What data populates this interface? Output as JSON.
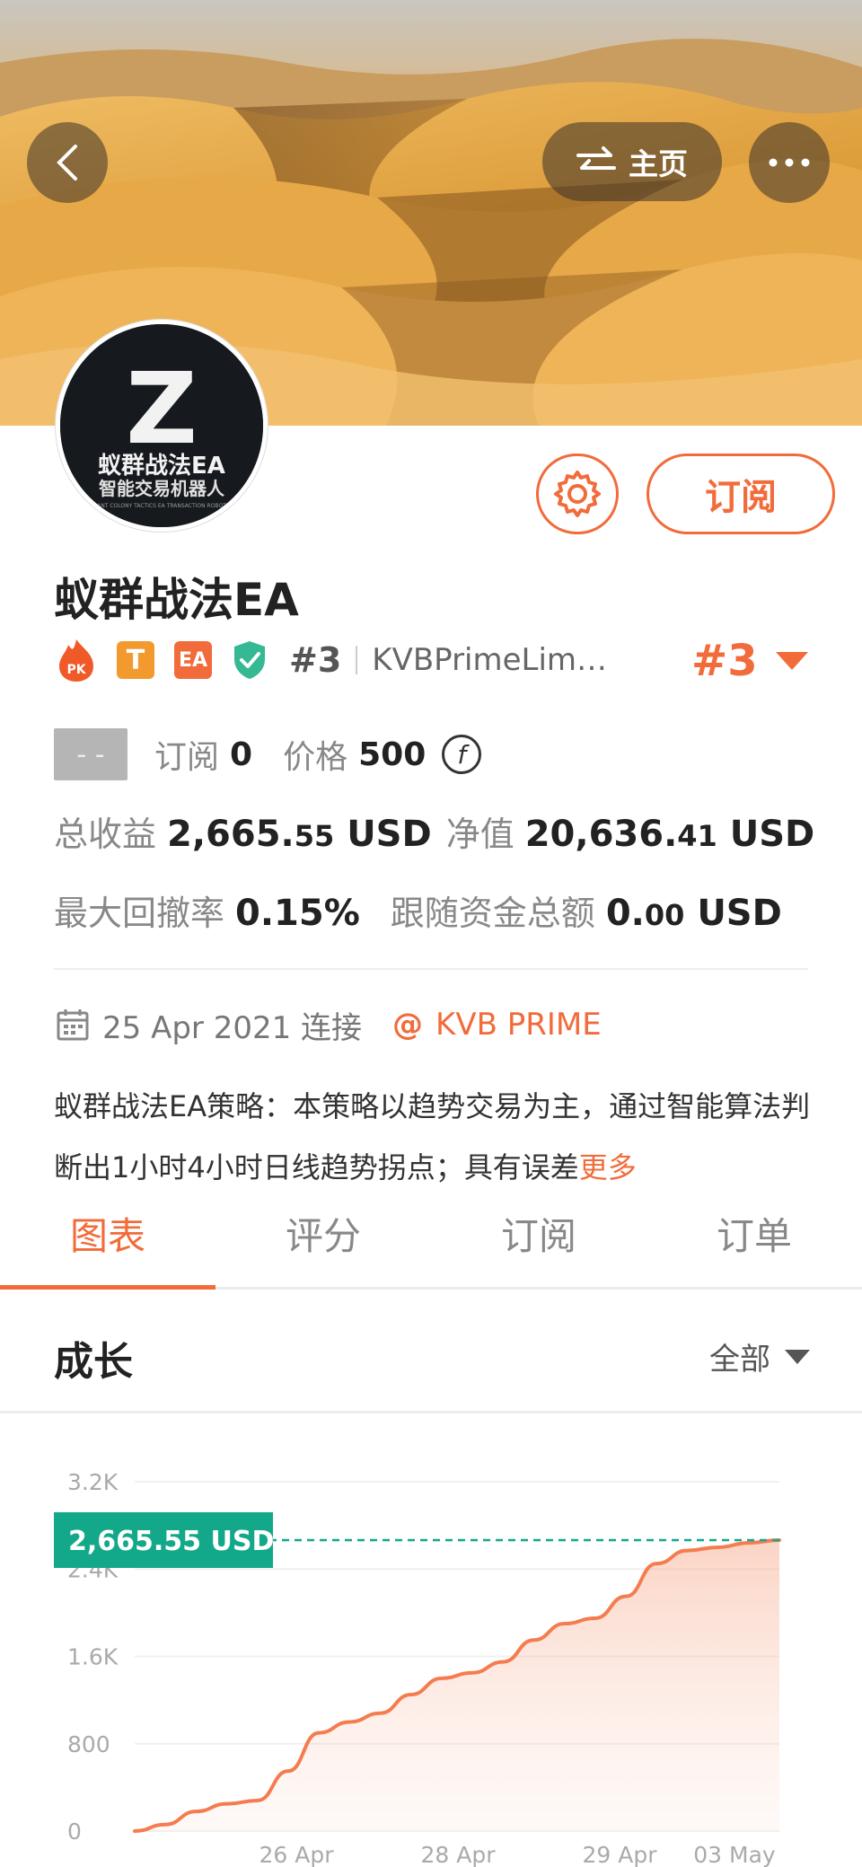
{
  "header": {
    "home_label": "主页",
    "avatar_logo_letter": "Z",
    "avatar_logo_title": "蚁群战法EA",
    "avatar_logo_subtitle": "智能交易机器人",
    "avatar_logo_tagline": "ANT COLONY TACTICS EA TRANSACTION ROBOT"
  },
  "profile": {
    "subscribe_label": "订阅",
    "name": "蚁群战法EA",
    "badges": {
      "pk": "PK",
      "t": "T",
      "ea": "EA"
    },
    "rank": "#3",
    "broker": "KVBPrimeLim…",
    "rank_big": "#3"
  },
  "stats": {
    "tag": "- -",
    "subs_label": "订阅",
    "subs_value": "0",
    "price_label": "价格",
    "price_value": "500",
    "coin_symbol": "f",
    "total_income_label": "总收益",
    "total_income_int": "2,665.",
    "total_income_dec": "55",
    "total_income_unit": "USD",
    "equity_label": "净值",
    "equity_int": "20,636.",
    "equity_dec": "41",
    "equity_unit": "USD",
    "drawdown_label": "最大回撤率",
    "drawdown_value": "0.15%",
    "follow_label": "跟随资金总额",
    "follow_int": "0.",
    "follow_dec": "00",
    "follow_unit": "USD"
  },
  "meta": {
    "connected": "25 Apr 2021 连接",
    "broker_tag": "KVB PRIME"
  },
  "description": {
    "text": "蚁群战法EA策略：本策略以趋势交易为主，通过智能算法判断出1小时4小时日线趋势拐点；具有误差",
    "more": "更多"
  },
  "tabs": [
    "图表",
    "评分",
    "订阅",
    "订单"
  ],
  "growth": {
    "title": "成长",
    "range": "全部"
  },
  "colors": {
    "accent": "#f26b3a",
    "green": "#14a88a",
    "line": "#f47c4f"
  },
  "chart_data": {
    "type": "area",
    "y_ticks": [
      "3.2K",
      "2.4K",
      "1.6K",
      "800",
      "0"
    ],
    "y_tick_values": [
      3200,
      2400,
      1600,
      800,
      0
    ],
    "x_ticks": [
      "26 Apr",
      "28 Apr",
      "29 Apr",
      "03 May"
    ],
    "ylim": [
      0,
      3200
    ],
    "current_label": "2,665.55 USD",
    "current_value": 2665.55,
    "series": [
      {
        "values": [
          0,
          60,
          180,
          250,
          280,
          550,
          900,
          1000,
          1080,
          1250,
          1400,
          1450,
          1550,
          1750,
          1900,
          1950,
          2150,
          2450,
          2570,
          2600,
          2640,
          2665.55
        ]
      }
    ]
  }
}
